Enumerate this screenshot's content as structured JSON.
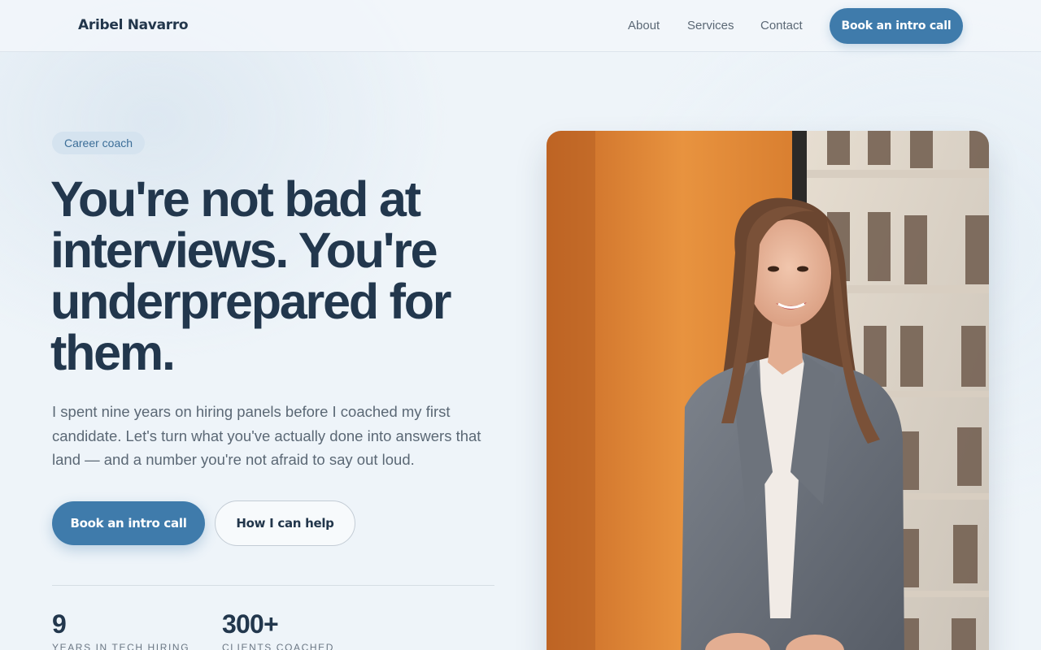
{
  "header": {
    "brand": "Aribel Navarro",
    "nav": {
      "about": "About",
      "services": "Services",
      "contact": "Contact"
    },
    "cta": "Book an intro call"
  },
  "hero": {
    "badge": "Career coach",
    "headline": "You're not bad at interviews. You're underprepared for them.",
    "lede": "I spent nine years on hiring panels before I coached my first candidate. Let's turn what you've actually done into answers that land — and a number you're not afraid to say out loud.",
    "primary_button": "Book an intro call",
    "secondary_button": "How I can help",
    "stats": [
      {
        "value": "9",
        "label": "YEARS IN TECH HIRING"
      },
      {
        "value": "300+",
        "label": "CLIENTS COACHED"
      }
    ]
  },
  "colors": {
    "accent": "#3f7bab",
    "heading": "#22374d",
    "body_text": "#5b6875",
    "background": "#eef4f9"
  }
}
